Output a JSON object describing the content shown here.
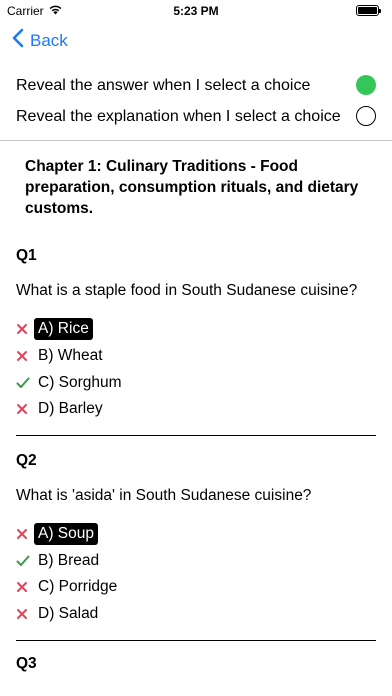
{
  "status_bar": {
    "carrier": "Carrier",
    "time": "5:23 PM"
  },
  "nav": {
    "back_label": "Back"
  },
  "settings": [
    {
      "label": "Reveal the answer when I select a choice",
      "enabled": true
    },
    {
      "label": "Reveal the explanation when I select a choice",
      "enabled": false
    }
  ],
  "chapter_title": "Chapter 1: Culinary Traditions - Food preparation, consumption rituals, and dietary customs.",
  "questions": [
    {
      "label": "Q1",
      "text": "What is a staple food in South Sudanese cuisine?",
      "choices": [
        {
          "label": "A) Rice",
          "mark": "cross",
          "selected": true
        },
        {
          "label": "B) Wheat",
          "mark": "cross",
          "selected": false
        },
        {
          "label": "C) Sorghum",
          "mark": "check",
          "selected": false
        },
        {
          "label": "D) Barley",
          "mark": "cross",
          "selected": false
        }
      ]
    },
    {
      "label": "Q2",
      "text": "What is 'asida' in South Sudanese cuisine?",
      "choices": [
        {
          "label": "A) Soup",
          "mark": "cross",
          "selected": true
        },
        {
          "label": "B) Bread",
          "mark": "check",
          "selected": false
        },
        {
          "label": "C) Porridge",
          "mark": "cross",
          "selected": false
        },
        {
          "label": "D) Salad",
          "mark": "cross",
          "selected": false
        }
      ]
    },
    {
      "label": "Q3"
    }
  ],
  "colors": {
    "accent": "#1a7cf5",
    "toggle_on": "#34c659",
    "cross": "#e2445c",
    "check": "#3a9a4a"
  },
  "icons": {
    "wifi": "wifi-icon",
    "battery": "battery-icon",
    "back": "chevron-left-icon",
    "cross": "x-mark-icon",
    "check": "checkmark-icon"
  }
}
